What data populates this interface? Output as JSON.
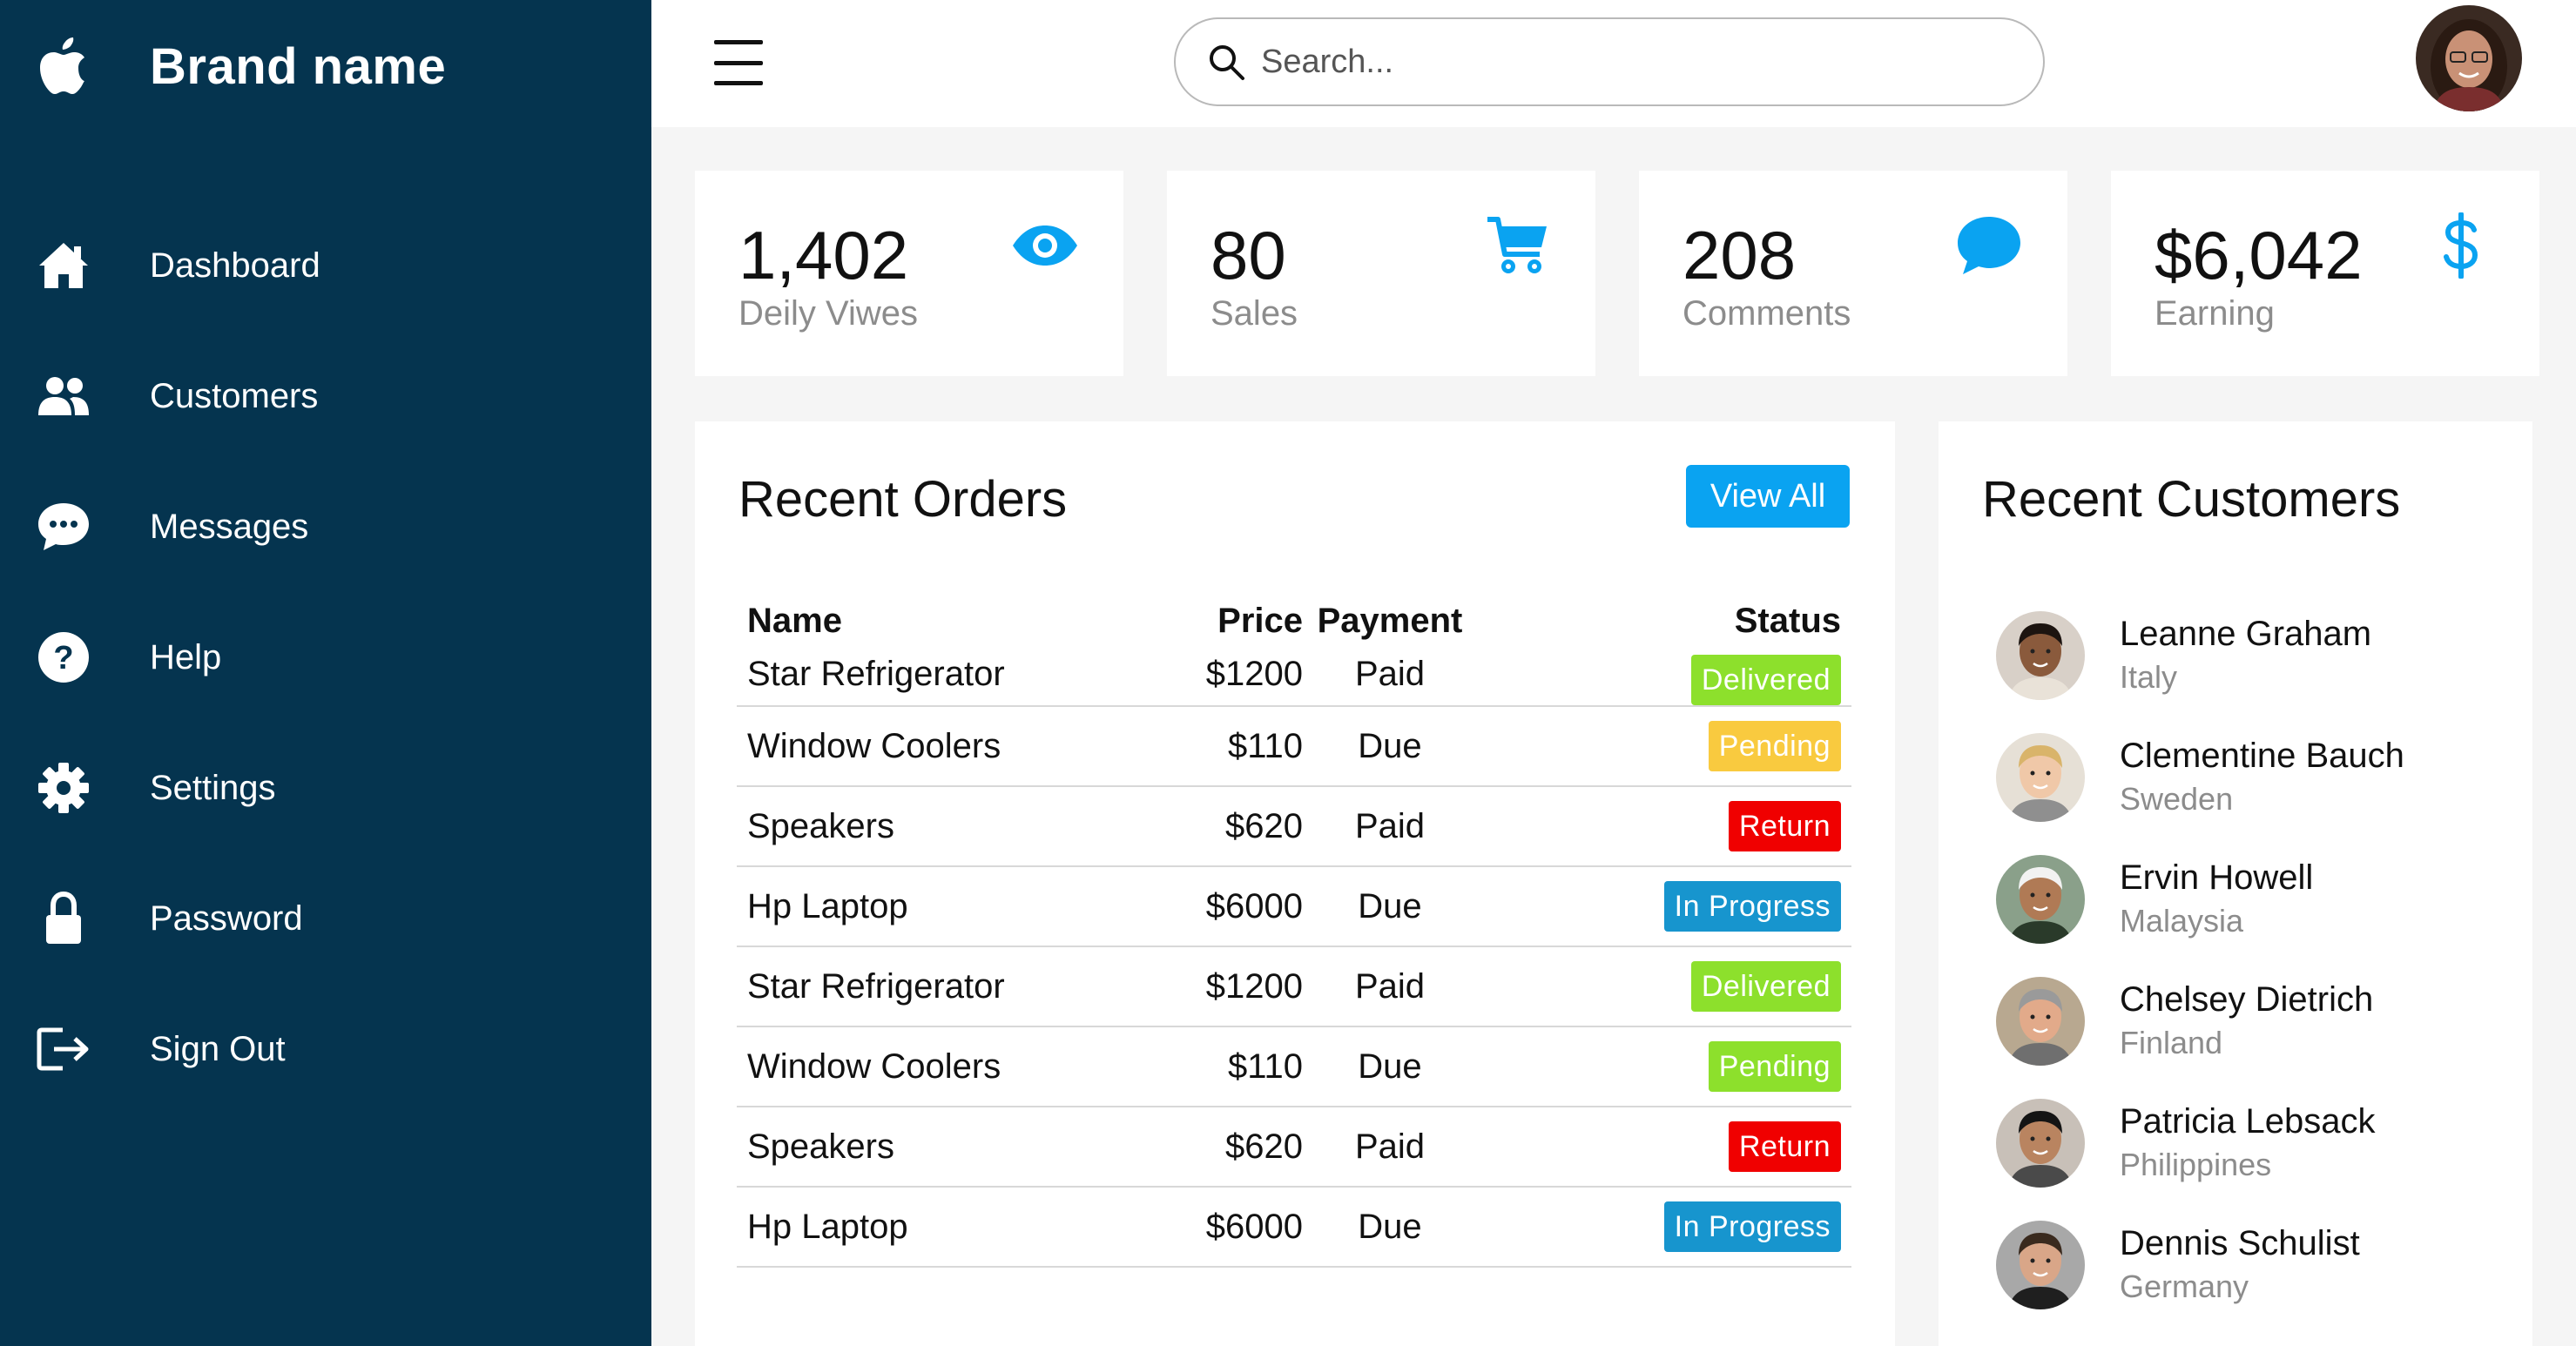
{
  "brand": {
    "name": "Brand name"
  },
  "nav": [
    {
      "label": "Dashboard",
      "icon": "home-icon"
    },
    {
      "label": "Customers",
      "icon": "people-icon"
    },
    {
      "label": "Messages",
      "icon": "chat-icon"
    },
    {
      "label": "Help",
      "icon": "help-icon"
    },
    {
      "label": "Settings",
      "icon": "gear-icon"
    },
    {
      "label": "Password",
      "icon": "lock-icon"
    },
    {
      "label": "Sign Out",
      "icon": "signout-icon"
    }
  ],
  "search": {
    "placeholder": "Search..."
  },
  "stats": [
    {
      "value": "1,402",
      "label": "Deily Viwes",
      "icon": "eye-icon"
    },
    {
      "value": "80",
      "label": "Sales",
      "icon": "cart-icon"
    },
    {
      "value": "208",
      "label": "Comments",
      "icon": "comment-icon"
    },
    {
      "value": "$6,042",
      "label": "Earning",
      "icon": "dollar-icon"
    }
  ],
  "orders": {
    "title": "Recent Orders",
    "view_all": "View All",
    "columns": [
      "Name",
      "Price",
      "Payment",
      "Status"
    ],
    "rows": [
      {
        "name": "Star Refrigerator",
        "price": "$1200",
        "payment": "Paid",
        "status": "Delivered",
        "status_color": "#8de02c"
      },
      {
        "name": "Window Coolers",
        "price": "$110",
        "payment": "Due",
        "status": "Pending",
        "status_color": "#f9ca3f"
      },
      {
        "name": "Speakers",
        "price": "$620",
        "payment": "Paid",
        "status": "Return",
        "status_color": "#f00000"
      },
      {
        "name": "Hp Laptop",
        "price": "$6000",
        "payment": "Due",
        "status": "In Progress",
        "status_color": "#1795ce"
      },
      {
        "name": "Star Refrigerator",
        "price": "$1200",
        "payment": "Paid",
        "status": "Delivered",
        "status_color": "#8de02c"
      },
      {
        "name": "Window Coolers",
        "price": "$110",
        "payment": "Due",
        "status": "Pending",
        "status_color": "#8de02c"
      },
      {
        "name": "Speakers",
        "price": "$620",
        "payment": "Paid",
        "status": "Return",
        "status_color": "#f00000"
      },
      {
        "name": "Hp Laptop",
        "price": "$6000",
        "payment": "Due",
        "status": "In Progress",
        "status_color": "#1795ce"
      }
    ]
  },
  "customers": {
    "title": "Recent Customers",
    "items": [
      {
        "name": "Leanne Graham",
        "country": "Italy"
      },
      {
        "name": "Clementine Bauch",
        "country": "Sweden"
      },
      {
        "name": "Ervin Howell",
        "country": "Malaysia"
      },
      {
        "name": "Chelsey Dietrich",
        "country": "Finland"
      },
      {
        "name": "Patricia Lebsack",
        "country": "Philippines"
      },
      {
        "name": "Dennis Schulist",
        "country": "Germany"
      }
    ]
  },
  "colors": {
    "sidebar": "#05344f",
    "accent": "#0aa3f1",
    "background": "#f5f5f5"
  }
}
